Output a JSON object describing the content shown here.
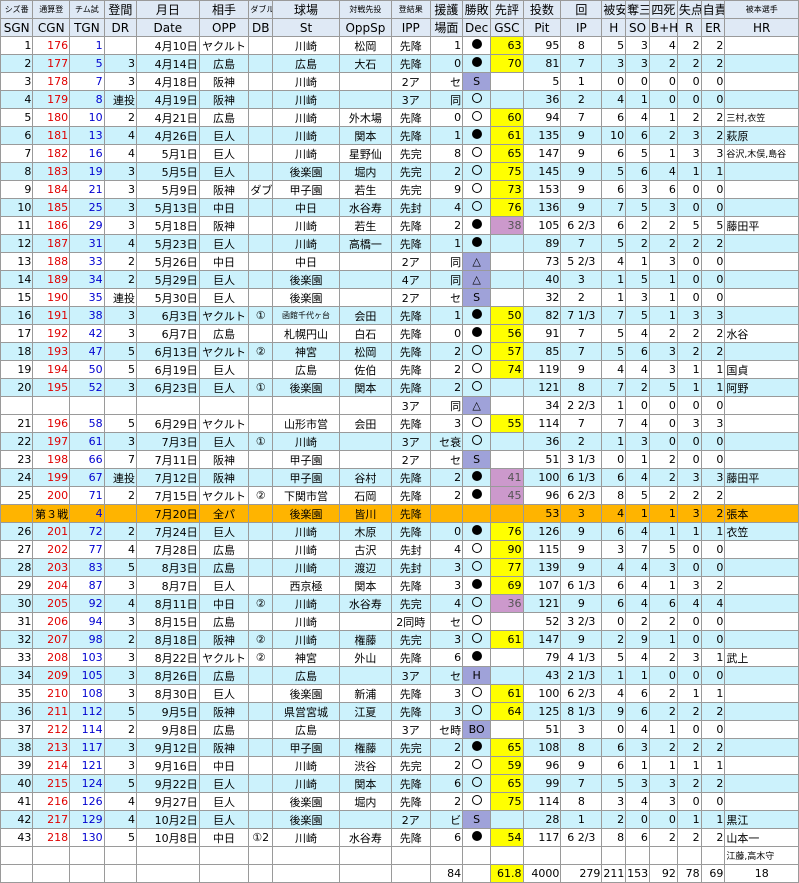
{
  "header_top": [
    "シズ番",
    "通算登",
    "チム試",
    "登間",
    "月日",
    "相手",
    "ダブル",
    "球場",
    "対戦先投",
    "登結果",
    "援護",
    "勝敗",
    "先評",
    "投数",
    "回",
    "被安",
    "奪三",
    "四死",
    "失点",
    "自責",
    "被本選手"
  ],
  "header_bottom": [
    "SGN",
    "CGN",
    "TGN",
    "DR",
    "Date",
    "OPP",
    "DB",
    "St",
    "OppSp",
    "IPP",
    "場面",
    "Dec",
    "GSC",
    "Pit",
    "IP",
    "H",
    "SO",
    "B+H",
    "R",
    "ER",
    "HR"
  ],
  "rows": [
    [
      "1",
      "176",
      "1",
      "",
      "4月10日",
      "ヤクルト",
      "",
      "川崎",
      "松岡",
      "先降",
      "1",
      "●",
      "63",
      "95",
      "8",
      "5",
      "3",
      "4",
      "2",
      "2",
      ""
    ],
    [
      "2",
      "177",
      "5",
      "3",
      "4月14日",
      "広島",
      "",
      "広島",
      "大石",
      "先降",
      "0",
      "●",
      "70",
      "81",
      "7",
      "3",
      "3",
      "2",
      "2",
      "2",
      ""
    ],
    [
      "3",
      "178",
      "7",
      "3",
      "4月18日",
      "阪神",
      "",
      "川崎",
      "",
      "2ア",
      "セ",
      "S",
      "",
      "5",
      "1",
      "0",
      "0",
      "0",
      "0",
      "0",
      ""
    ],
    [
      "4",
      "179",
      "8",
      "連投",
      "4月19日",
      "阪神",
      "",
      "川崎",
      "",
      "3ア",
      "同",
      "○",
      "",
      "36",
      "2",
      "4",
      "1",
      "0",
      "0",
      "0",
      ""
    ],
    [
      "5",
      "180",
      "10",
      "2",
      "4月21日",
      "広島",
      "",
      "川崎",
      "外木場",
      "先降",
      "0",
      "○",
      "60",
      "94",
      "7",
      "6",
      "4",
      "1",
      "2",
      "2",
      "三村,衣笠"
    ],
    [
      "6",
      "181",
      "13",
      "4",
      "4月26日",
      "巨人",
      "",
      "川崎",
      "関本",
      "先降",
      "1",
      "●",
      "61",
      "135",
      "9",
      "10",
      "6",
      "2",
      "3",
      "2",
      "萩原"
    ],
    [
      "7",
      "182",
      "16",
      "4",
      "5月1日",
      "巨人",
      "",
      "川崎",
      "星野仙",
      "先完",
      "8",
      "○",
      "65",
      "147",
      "9",
      "6",
      "5",
      "1",
      "3",
      "3",
      "谷沢,木俣,島谷"
    ],
    [
      "8",
      "183",
      "19",
      "3",
      "5月5日",
      "巨人",
      "",
      "後楽園",
      "堀内",
      "先完",
      "2",
      "○",
      "75",
      "145",
      "9",
      "5",
      "6",
      "4",
      "1",
      "1",
      ""
    ],
    [
      "9",
      "184",
      "21",
      "3",
      "5月9日",
      "阪神",
      "ダブル",
      "甲子園",
      "若生",
      "先完",
      "9",
      "○",
      "73",
      "153",
      "9",
      "6",
      "3",
      "6",
      "0",
      "0",
      ""
    ],
    [
      "10",
      "185",
      "25",
      "3",
      "5月13日",
      "中日",
      "",
      "中日",
      "水谷寿",
      "先封",
      "4",
      "○",
      "76",
      "136",
      "9",
      "7",
      "5",
      "3",
      "0",
      "0",
      ""
    ],
    [
      "11",
      "186",
      "29",
      "3",
      "5月18日",
      "阪神",
      "",
      "川崎",
      "若生",
      "先降",
      "2",
      "●",
      "38",
      "105",
      "6 2/3",
      "6",
      "2",
      "2",
      "5",
      "5",
      "藤田平"
    ],
    [
      "12",
      "187",
      "31",
      "4",
      "5月23日",
      "巨人",
      "",
      "川崎",
      "高橋一",
      "先降",
      "1",
      "●",
      "",
      "89",
      "7",
      "5",
      "2",
      "2",
      "2",
      "2",
      ""
    ],
    [
      "13",
      "188",
      "33",
      "2",
      "5月26日",
      "中日",
      "",
      "中日",
      "",
      "2ア",
      "同",
      "△",
      "",
      "73",
      "5 2/3",
      "4",
      "1",
      "3",
      "0",
      "0",
      ""
    ],
    [
      "14",
      "189",
      "34",
      "2",
      "5月29日",
      "巨人",
      "",
      "後楽園",
      "",
      "4ア",
      "同",
      "△",
      "",
      "40",
      "3",
      "1",
      "5",
      "1",
      "0",
      "0",
      ""
    ],
    [
      "15",
      "190",
      "35",
      "連投",
      "5月30日",
      "巨人",
      "",
      "後楽園",
      "",
      "2ア",
      "セ",
      "S",
      "",
      "32",
      "2",
      "1",
      "3",
      "1",
      "0",
      "0",
      ""
    ],
    [
      "16",
      "191",
      "38",
      "3",
      "6月3日",
      "ヤクルト",
      "①",
      "函館千代ヶ台",
      "会田",
      "先降",
      "1",
      "●",
      "50",
      "82",
      "7 1/3",
      "7",
      "5",
      "1",
      "3",
      "3",
      ""
    ],
    [
      "17",
      "192",
      "42",
      "3",
      "6月7日",
      "広島",
      "",
      "札幌円山",
      "白石",
      "先降",
      "0",
      "●",
      "56",
      "91",
      "7",
      "5",
      "4",
      "2",
      "2",
      "2",
      "水谷"
    ],
    [
      "18",
      "193",
      "47",
      "5",
      "6月13日",
      "ヤクルト",
      "②",
      "神宮",
      "松岡",
      "先降",
      "2",
      "○",
      "57",
      "85",
      "7",
      "5",
      "6",
      "3",
      "2",
      "2",
      ""
    ],
    [
      "19",
      "194",
      "50",
      "5",
      "6月19日",
      "巨人",
      "",
      "広島",
      "佐伯",
      "先降",
      "2",
      "○",
      "74",
      "119",
      "9",
      "4",
      "4",
      "3",
      "1",
      "1",
      "国貞"
    ],
    [
      "20",
      "195",
      "52",
      "3",
      "6月23日",
      "巨人",
      "①",
      "後楽園",
      "関本",
      "先降",
      "2",
      "○",
      "",
      "121",
      "8",
      "7",
      "2",
      "5",
      "1",
      "1",
      "阿野"
    ],
    [
      "",
      "",
      "",
      "",
      "",
      "",
      "",
      "",
      "",
      "3ア",
      "同",
      "△",
      "",
      "34",
      "2 2/3",
      "1",
      "0",
      "0",
      "0",
      "0",
      ""
    ],
    [
      "21",
      "196",
      "58",
      "5",
      "6月29日",
      "ヤクルト",
      "",
      "山形市営",
      "会田",
      "先降",
      "3",
      "○",
      "55",
      "114",
      "7",
      "7",
      "4",
      "0",
      "3",
      "3",
      ""
    ],
    [
      "22",
      "197",
      "61",
      "3",
      "7月3日",
      "巨人",
      "①",
      "川崎",
      "",
      "3ア",
      "セ衰",
      "○",
      "",
      "36",
      "2",
      "1",
      "3",
      "0",
      "0",
      "0",
      ""
    ],
    [
      "23",
      "198",
      "66",
      "7",
      "7月11日",
      "阪神",
      "",
      "甲子園",
      "",
      "2ア",
      "セ",
      "S",
      "",
      "51",
      "3 1/3",
      "0",
      "1",
      "2",
      "0",
      "0",
      ""
    ],
    [
      "24",
      "199",
      "67",
      "連投",
      "7月12日",
      "阪神",
      "",
      "甲子園",
      "谷村",
      "先降",
      "2",
      "●",
      "41",
      "100",
      "6 1/3",
      "6",
      "4",
      "2",
      "3",
      "3",
      "藤田平"
    ],
    [
      "25",
      "200",
      "71",
      "2",
      "7月15日",
      "ヤクルト",
      "②",
      "下関市営",
      "石岡",
      "先降",
      "2",
      "●",
      "45",
      "96",
      "6 2/3",
      "8",
      "5",
      "2",
      "2",
      "2",
      ""
    ],
    [
      "",
      "第３戦",
      "4",
      "",
      "7月20日",
      "全パ",
      "",
      "後楽園",
      "皆川",
      "先降",
      "",
      "",
      "",
      "53",
      "3",
      "4",
      "1",
      "1",
      "3",
      "2",
      "張本"
    ],
    [
      "26",
      "201",
      "72",
      "2",
      "7月24日",
      "巨人",
      "",
      "川崎",
      "木原",
      "先降",
      "0",
      "●",
      "76",
      "126",
      "9",
      "6",
      "4",
      "1",
      "1",
      "1",
      "衣笠"
    ],
    [
      "27",
      "202",
      "77",
      "4",
      "7月28日",
      "広島",
      "",
      "川崎",
      "古沢",
      "先封",
      "4",
      "○",
      "90",
      "115",
      "9",
      "3",
      "7",
      "5",
      "0",
      "0",
      ""
    ],
    [
      "28",
      "203",
      "83",
      "5",
      "8月3日",
      "広島",
      "",
      "川崎",
      "渡辺",
      "先封",
      "3",
      "○",
      "77",
      "139",
      "9",
      "4",
      "4",
      "3",
      "0",
      "0",
      ""
    ],
    [
      "29",
      "204",
      "87",
      "3",
      "8月7日",
      "巨人",
      "",
      "西京極",
      "関本",
      "先降",
      "3",
      "●",
      "69",
      "107",
      "6 1/3",
      "6",
      "4",
      "1",
      "3",
      "2",
      ""
    ],
    [
      "30",
      "205",
      "92",
      "4",
      "8月11日",
      "中日",
      "②",
      "川崎",
      "水谷寿",
      "先完",
      "4",
      "○",
      "36",
      "121",
      "9",
      "6",
      "4",
      "6",
      "4",
      "4",
      ""
    ],
    [
      "31",
      "206",
      "94",
      "3",
      "8月15日",
      "広島",
      "",
      "川崎",
      "",
      "2同時",
      "セ",
      "○",
      "",
      "52",
      "3 2/3",
      "0",
      "2",
      "2",
      "0",
      "0",
      ""
    ],
    [
      "32",
      "207",
      "98",
      "2",
      "8月18日",
      "阪神",
      "②",
      "川崎",
      "権藤",
      "先完",
      "3",
      "○",
      "61",
      "147",
      "9",
      "2",
      "9",
      "1",
      "0",
      "0",
      ""
    ],
    [
      "33",
      "208",
      "103",
      "3",
      "8月22日",
      "ヤクルト",
      "②",
      "神宮",
      "外山",
      "先降",
      "6",
      "●",
      "",
      "79",
      "4 1/3",
      "5",
      "4",
      "2",
      "3",
      "1",
      "武上"
    ],
    [
      "34",
      "209",
      "105",
      "3",
      "8月26日",
      "広島",
      "",
      "広島",
      "",
      "3ア",
      "セ",
      "H",
      "",
      "43",
      "2 1/3",
      "1",
      "1",
      "0",
      "0",
      "0",
      ""
    ],
    [
      "35",
      "210",
      "108",
      "3",
      "8月30日",
      "巨人",
      "",
      "後楽園",
      "新浦",
      "先降",
      "3",
      "○",
      "61",
      "100",
      "6 2/3",
      "4",
      "6",
      "2",
      "1",
      "1",
      ""
    ],
    [
      "36",
      "211",
      "112",
      "5",
      "9月5日",
      "阪神",
      "",
      "県営宮城",
      "江夏",
      "先降",
      "3",
      "○",
      "64",
      "125",
      "8 1/3",
      "9",
      "6",
      "2",
      "2",
      "2",
      ""
    ],
    [
      "37",
      "212",
      "114",
      "2",
      "9月8日",
      "広島",
      "",
      "広島",
      "",
      "3ア",
      "セ時",
      "BO",
      "",
      "51",
      "3",
      "0",
      "4",
      "1",
      "0",
      "0",
      ""
    ],
    [
      "38",
      "213",
      "117",
      "3",
      "9月12日",
      "阪神",
      "",
      "甲子園",
      "権藤",
      "先完",
      "2",
      "●",
      "65",
      "108",
      "8",
      "6",
      "3",
      "2",
      "2",
      "2",
      ""
    ],
    [
      "39",
      "214",
      "121",
      "3",
      "9月16日",
      "中日",
      "",
      "川崎",
      "渋谷",
      "先完",
      "2",
      "○",
      "59",
      "96",
      "9",
      "6",
      "1",
      "1",
      "1",
      "1",
      ""
    ],
    [
      "40",
      "215",
      "124",
      "5",
      "9月22日",
      "巨人",
      "",
      "川崎",
      "関本",
      "先降",
      "6",
      "○",
      "65",
      "99",
      "7",
      "5",
      "3",
      "3",
      "2",
      "2",
      ""
    ],
    [
      "41",
      "216",
      "126",
      "4",
      "9月27日",
      "巨人",
      "",
      "後楽園",
      "堀内",
      "先降",
      "2",
      "○",
      "75",
      "114",
      "8",
      "3",
      "4",
      "3",
      "0",
      "0",
      ""
    ],
    [
      "42",
      "217",
      "129",
      "4",
      "10月2日",
      "巨人",
      "",
      "後楽園",
      "",
      "2ア",
      "ビ",
      "S",
      "",
      "28",
      "1",
      "2",
      "0",
      "0",
      "1",
      "1",
      "黒江"
    ],
    [
      "43",
      "218",
      "130",
      "5",
      "10月8日",
      "中日",
      "①2",
      "川崎",
      "水谷寿",
      "先降",
      "6",
      "●",
      "54",
      "117",
      "6 2/3",
      "8",
      "6",
      "2",
      "2",
      "2",
      "山本一"
    ],
    [
      "",
      "",
      "",
      "",
      "",
      "",
      "",
      "",
      "",
      "",
      "",
      "",
      "",
      "",
      "",
      "",
      "",
      "",
      "",
      "",
      "江藤,高木守"
    ]
  ],
  "footer": [
    "",
    "",
    "",
    "",
    "",
    "",
    "",
    "",
    "",
    "",
    "84",
    "",
    "61.8",
    "4000",
    "279",
    "211",
    "153",
    "92",
    "78",
    "69",
    "18"
  ],
  "dec_names": {
    "●": "filled-circle",
    "○": "open-circle",
    "S": "save-mark",
    "△": "triangle-mark",
    "H": "hold-mark",
    "BO": "b-circle"
  },
  "colors": {
    "header_bg": "#dfe9f5",
    "row_alt": "#ccf2fc",
    "allstar": "#ffb400",
    "gsc_good": "#ffff00",
    "gsc_other": "#cc99cc",
    "relief": "#9fa2d9"
  }
}
